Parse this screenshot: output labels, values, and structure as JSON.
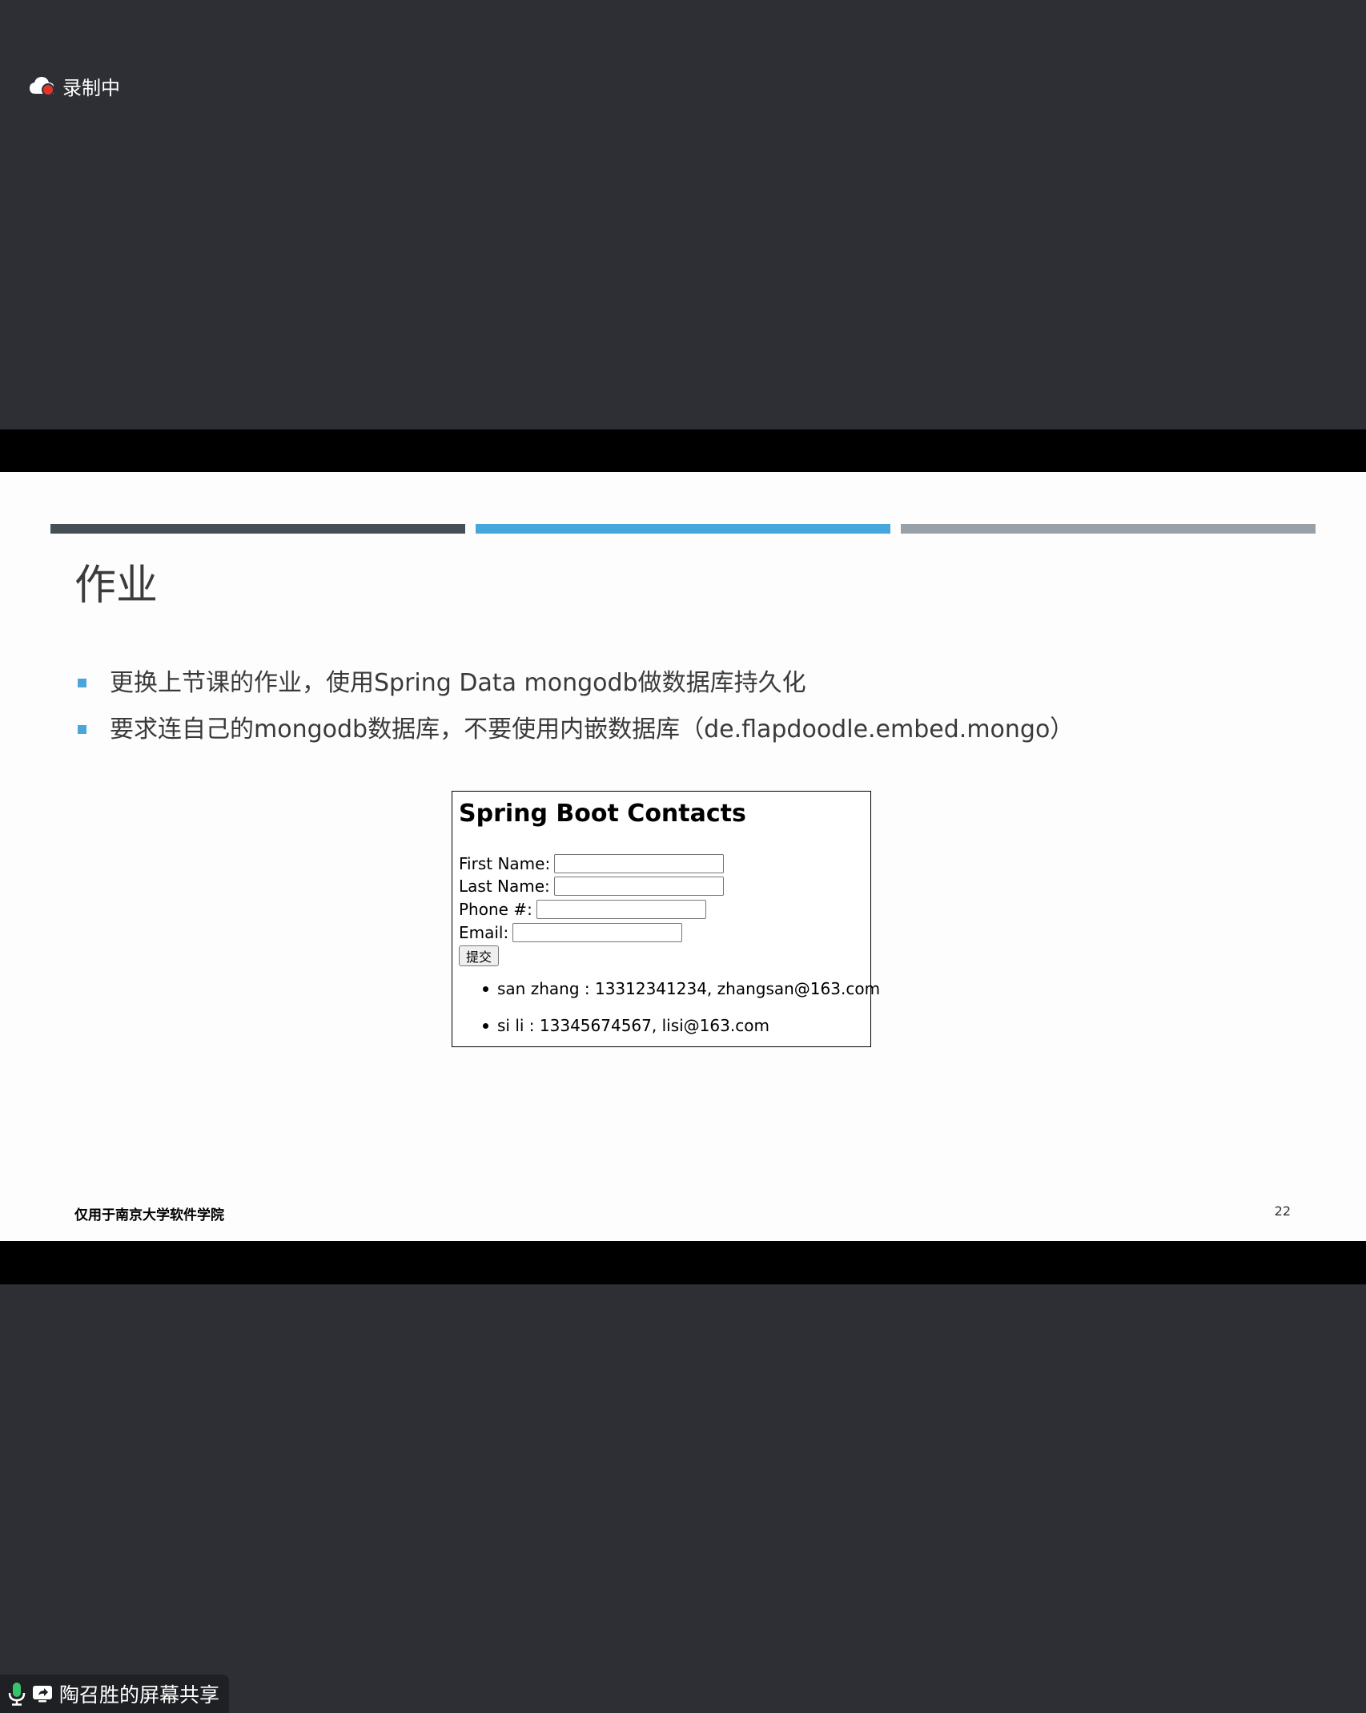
{
  "recording": {
    "label": "录制中"
  },
  "slide": {
    "stripe_colors": [
      "#464f55",
      "#45a7dc",
      "#98a1a8"
    ],
    "title": "作业",
    "bullets": [
      "更换上节课的作业，使用Spring Data mongodb做数据库持久化",
      "要求连自己的mongodb数据库，不要使用内嵌数据库（de.flapdoodle.embed.mongo）"
    ],
    "footer_left": "仅用于南京大学软件学院",
    "page_number": "22"
  },
  "webpage": {
    "title": "Spring Boot Contacts",
    "fields": {
      "first_name_label": "First Name:",
      "first_name_value": "",
      "last_name_label": "Last Name:",
      "last_name_value": "",
      "phone_label": "Phone #:",
      "phone_value": "",
      "email_label": "Email:",
      "email_value": ""
    },
    "submit_label": "提交",
    "contacts": [
      "san zhang : 13312341234, zhangsan@163.com",
      "si li : 13345674567, lisi@163.com"
    ]
  },
  "share": {
    "label": "陶召胜的屏幕共享",
    "mic_icon": "microphone-icon",
    "screen_icon": "screen-share-icon"
  }
}
